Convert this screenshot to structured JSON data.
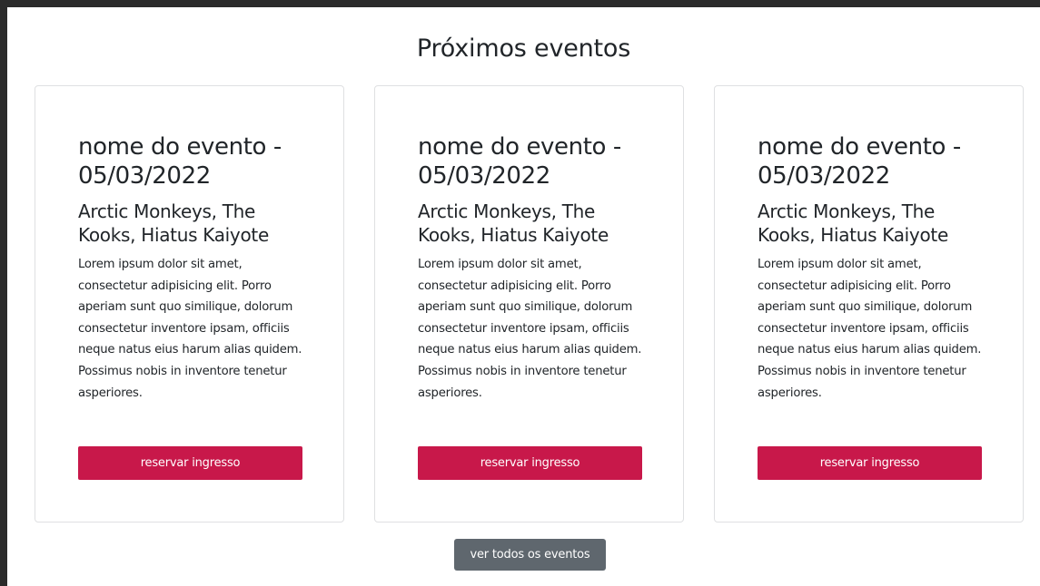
{
  "section": {
    "title": "Próximos eventos"
  },
  "events": [
    {
      "title": "nome do evento - 05/03/2022",
      "artists": "Arctic Monkeys, The Kooks, Hiatus Kaiyote",
      "description": "Lorem ipsum dolor sit amet, consectetur adipisicing elit. Porro aperiam sunt quo similique, dolorum consectetur inventore ipsam, officiis neque natus eius harum alias quidem. Possimus nobis in inventore tenetur asperiores.",
      "button_label": "reservar ingresso"
    },
    {
      "title": "nome do evento - 05/03/2022",
      "artists": "Arctic Monkeys, The Kooks, Hiatus Kaiyote",
      "description": "Lorem ipsum dolor sit amet, consectetur adipisicing elit. Porro aperiam sunt quo similique, dolorum consectetur inventore ipsam, officiis neque natus eius harum alias quidem. Possimus nobis in inventore tenetur asperiores.",
      "button_label": "reservar ingresso"
    },
    {
      "title": "nome do evento - 05/03/2022",
      "artists": "Arctic Monkeys, The Kooks, Hiatus Kaiyote",
      "description": "Lorem ipsum dolor sit amet, consectetur adipisicing elit. Porro aperiam sunt quo similique, dolorum consectetur inventore ipsam, officiis neque natus eius harum alias quidem. Possimus nobis in inventore tenetur asperiores.",
      "button_label": "reservar ingresso"
    }
  ],
  "footer": {
    "view_all_label": "ver todos os eventos"
  },
  "colors": {
    "reserve_button": "#c8184a",
    "view_all_button": "#5f676e",
    "page_background": "#ffffff",
    "frame_background": "#2b2b2b"
  }
}
